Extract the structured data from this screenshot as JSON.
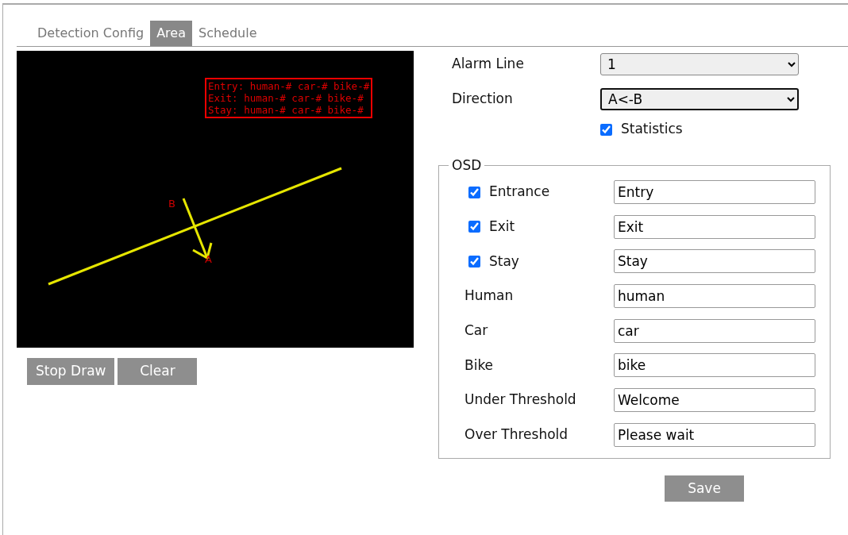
{
  "tabs": [
    {
      "label": "Detection Config",
      "selected": false
    },
    {
      "label": "Area",
      "selected": true
    },
    {
      "label": "Schedule",
      "selected": false
    }
  ],
  "video": {
    "osd_lines": [
      "Entry: human-# car-# bike-#",
      "Exit: human-# car-# bike-#",
      "Stay: human-# car-# bike-#"
    ],
    "point_b": "B",
    "point_a": "A"
  },
  "draw_buttons": [
    "Stop Draw",
    "Clear"
  ],
  "alarm_line": {
    "label": "Alarm Line",
    "value": "1"
  },
  "direction": {
    "label": "Direction",
    "value": "A<-B",
    "focused": true
  },
  "statistics": {
    "label": "Statistics",
    "checked": true
  },
  "osd": {
    "legend": "OSD",
    "rows": [
      {
        "kind": "checkbox",
        "label": "Entrance",
        "checked": true,
        "value": "Entry"
      },
      {
        "kind": "checkbox",
        "label": "Exit",
        "checked": true,
        "value": "Exit"
      },
      {
        "kind": "checkbox",
        "label": "Stay",
        "checked": true,
        "value": "Stay"
      },
      {
        "kind": "text",
        "label": "Human",
        "value": "human"
      },
      {
        "kind": "text",
        "label": "Car",
        "value": "car"
      },
      {
        "kind": "text",
        "label": "Bike",
        "value": "bike"
      },
      {
        "kind": "text",
        "label": "Under Threshold",
        "value": "Welcome"
      },
      {
        "kind": "text",
        "label": "Over Threshold",
        "value": "Please wait"
      }
    ]
  },
  "save_button": "Save"
}
